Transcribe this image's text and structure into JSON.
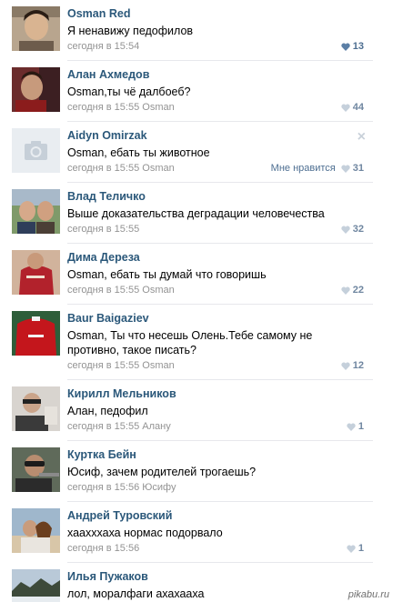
{
  "colors": {
    "author": "#2b587a",
    "meta": "#939393",
    "like_active": "#4d6e91",
    "like_idle": "#c5d0db"
  },
  "comments": [
    {
      "author": "Osman Red",
      "text": "Я ненавижу педофилов",
      "time": "сегодня в 15:54",
      "reply_to": "",
      "likes": "13",
      "liked": true
    },
    {
      "author": "Алан Ахмедов",
      "text": "Osman,ты чё далбоеб?",
      "time": "сегодня в 15:55",
      "reply_to": "Osman",
      "likes": "44",
      "liked": false
    },
    {
      "author": "Aidyn Omirzak",
      "text": "Osman, ебать ты животное",
      "time": "сегодня в 15:55",
      "reply_to": "Osman",
      "likes": "31",
      "liked": false,
      "like_label": "Мне нравится",
      "close_icon": "×"
    },
    {
      "author": "Влад Теличко",
      "text": "Выше доказательства деградации человечества",
      "time": "сегодня в 15:55",
      "reply_to": "",
      "likes": "32",
      "liked": false
    },
    {
      "author": "Дима Дереза",
      "text": "Osman, ебать ты думай что говоришь",
      "time": "сегодня в 15:55",
      "reply_to": "Osman",
      "likes": "22",
      "liked": false
    },
    {
      "author": "Baur Baigaziev",
      "text": "Osman, Ты что несешь Олень.Тебе самому не противно, такое писать?",
      "time": "сегодня в 15:55",
      "reply_to": "Osman",
      "likes": "12",
      "liked": false
    },
    {
      "author": "Кирилл Мельников",
      "text": "Алан, педофил",
      "time": "сегодня в 15:55",
      "reply_to": "Алану",
      "likes": "1",
      "liked": false
    },
    {
      "author": "Куртка Бейн",
      "text": "Юсиф, зачем родителей трогаешь?",
      "time": "сегодня в 15:56",
      "reply_to": "Юсифу",
      "likes": "",
      "liked": false
    },
    {
      "author": "Андрей Туровский",
      "text": "хаахххаха нормас подорвало",
      "time": "сегодня в 15:56",
      "reply_to": "",
      "likes": "1",
      "liked": false
    },
    {
      "author": "Илья Пужаков",
      "text": "лол, моралфаги ахахааха",
      "time": "",
      "reply_to": "",
      "likes": "",
      "liked": false
    }
  ],
  "watermark": "pikabu.ru"
}
